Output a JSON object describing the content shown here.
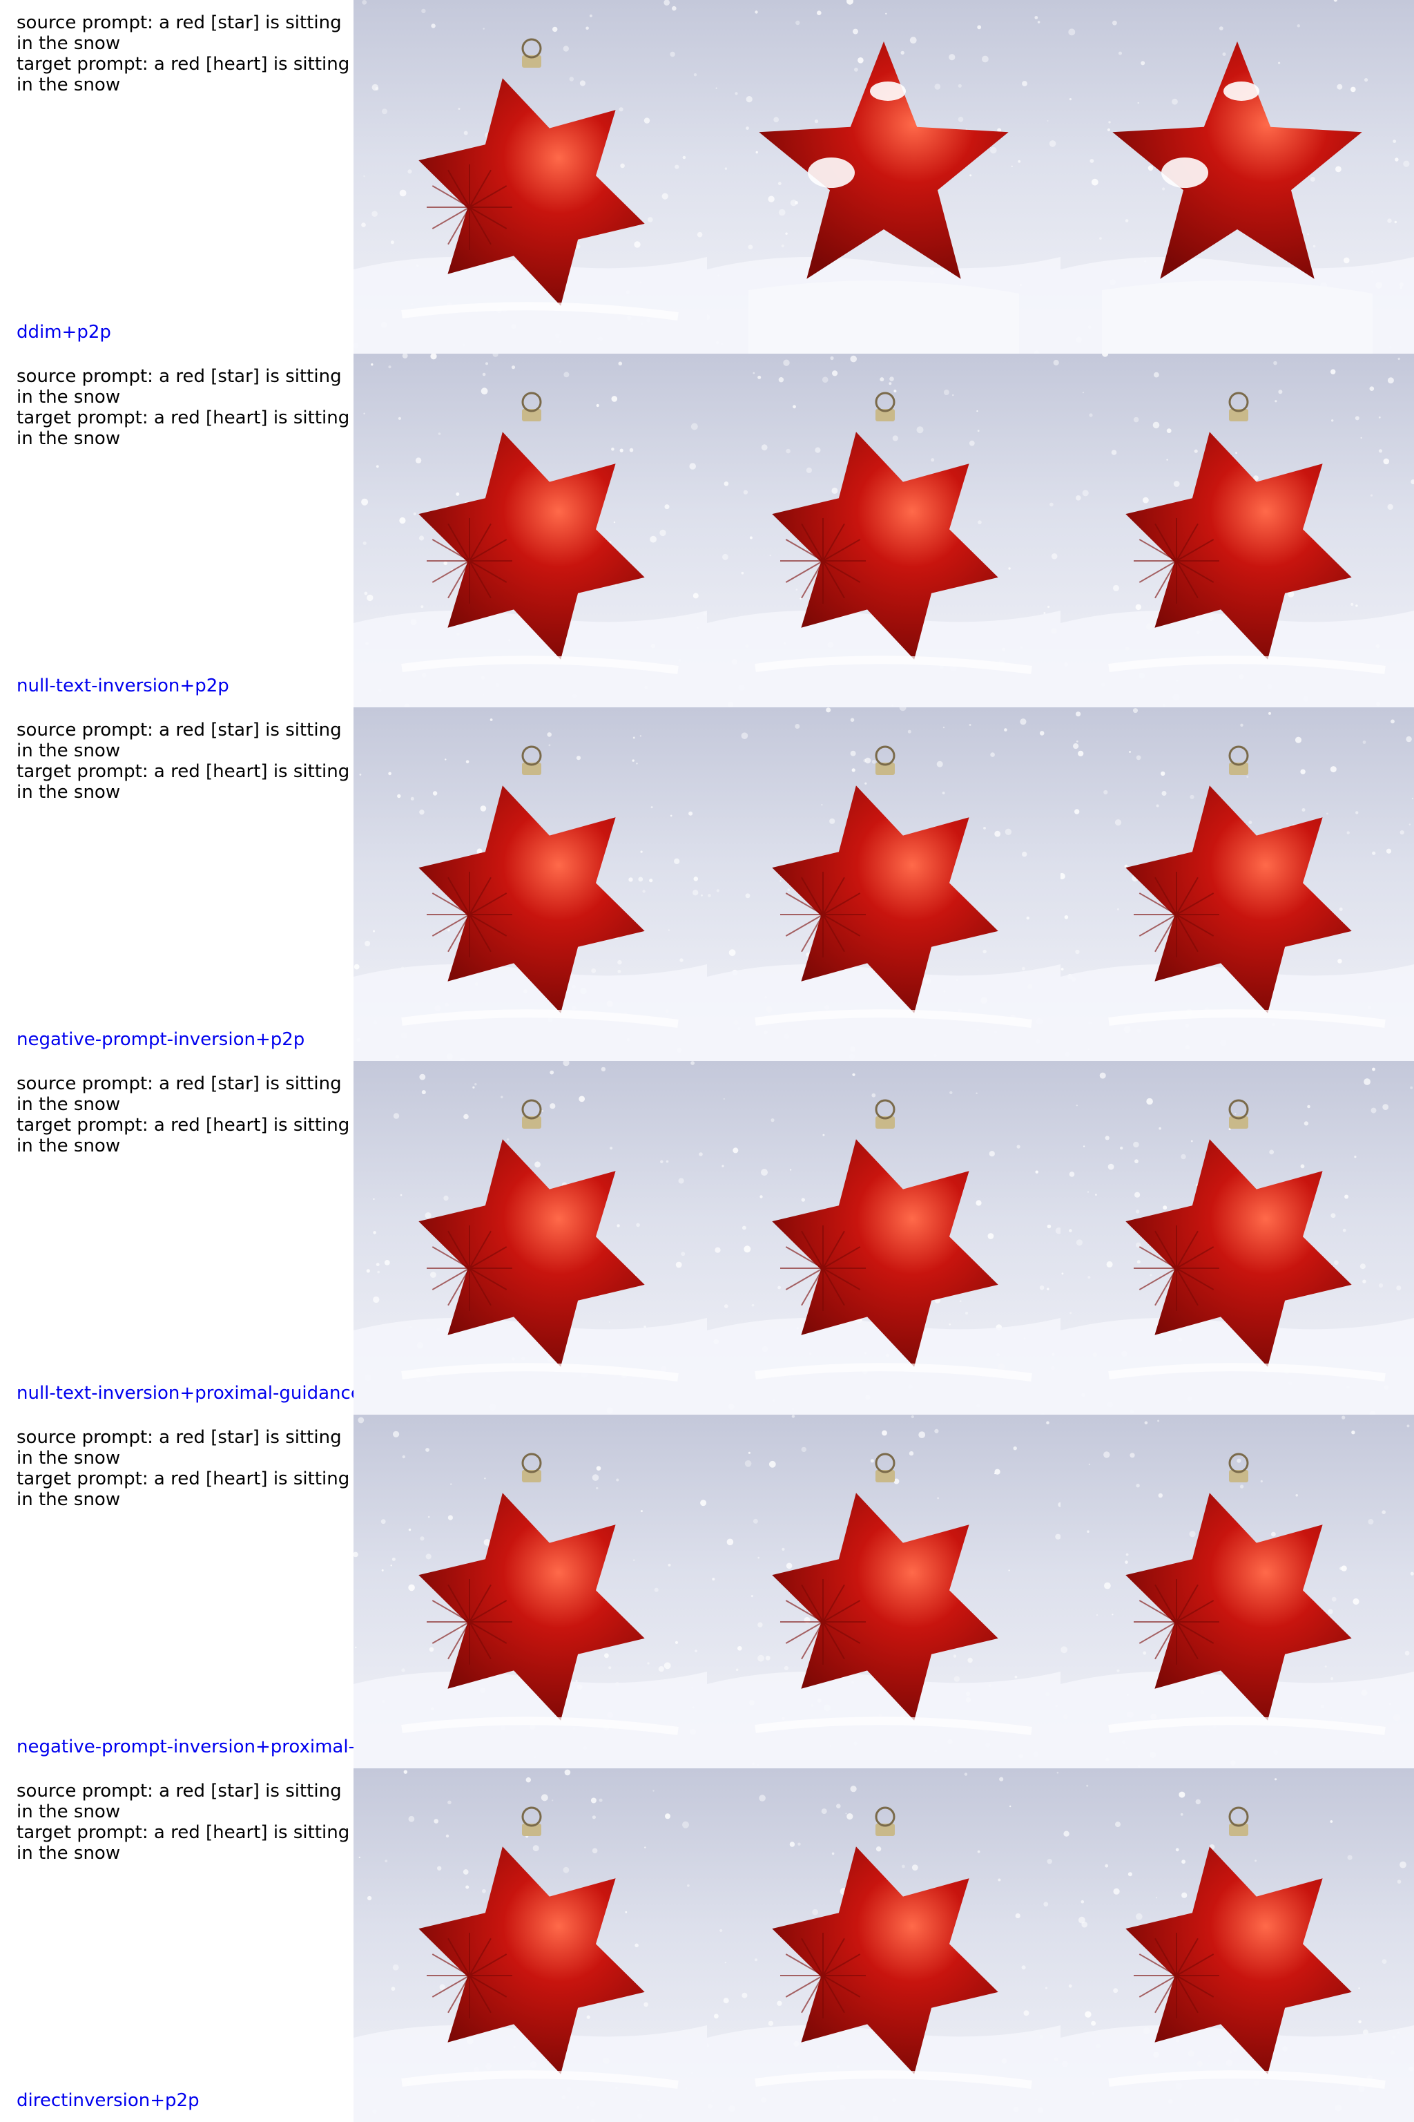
{
  "prompts": {
    "source": "source prompt: a red [star] is sitting in the snow",
    "target": "target prompt: a red [heart] is sitting in the snow"
  },
  "rows": [
    {
      "method": "ddim+p2p",
      "cells": [
        "snowy-star-ornament",
        "red-fabric-star-in-snow",
        "red-fabric-star-in-snow"
      ]
    },
    {
      "method": "null-text-inversion+p2p",
      "cells": [
        "snowy-star-ornament",
        "snowy-star-ornament",
        "snowy-star-ornament"
      ]
    },
    {
      "method": "negative-prompt-inversion+p2p",
      "cells": [
        "snowy-star-ornament",
        "snowy-star-ornament",
        "snowy-star-ornament"
      ]
    },
    {
      "method": "null-text-inversion+proximal-guidance",
      "cells": [
        "snowy-star-ornament",
        "snowy-star-ornament",
        "snowy-star-ornament"
      ]
    },
    {
      "method": "negative-prompt-inversion+proximal-g",
      "cells": [
        "snowy-star-ornament",
        "snowy-star-ornament",
        "snowy-star-ornament"
      ]
    },
    {
      "method": "directinversion+p2p",
      "cells": [
        "snowy-star-ornament",
        "snowy-star-ornament",
        "snowy-star-ornament"
      ]
    }
  ],
  "colors": {
    "prompt_text": "#000000",
    "method_label": "#0000ee",
    "snow_light": "#f1f2f8",
    "snow_shadow": "#c4c8da",
    "ornament_red": "#c8140e",
    "ornament_dark": "#7a0805",
    "ornament_highlight": "#ff6a4a"
  }
}
